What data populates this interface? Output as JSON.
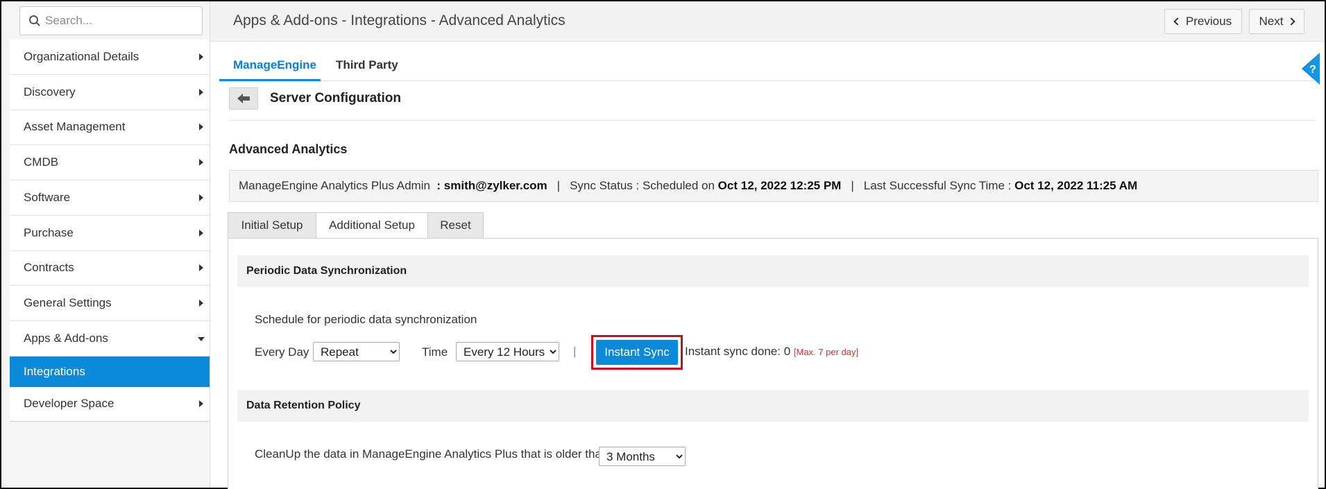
{
  "search": {
    "placeholder": "Search..."
  },
  "sidebar": {
    "items": [
      {
        "label": "Organizational Details"
      },
      {
        "label": "Discovery"
      },
      {
        "label": "Asset Management"
      },
      {
        "label": "CMDB"
      },
      {
        "label": "Software"
      },
      {
        "label": "Purchase"
      },
      {
        "label": "Contracts"
      },
      {
        "label": "General Settings"
      },
      {
        "label": "Apps & Add-ons"
      },
      {
        "label": "Integrations"
      },
      {
        "label": "Developer Space"
      }
    ]
  },
  "header": {
    "title": "Apps & Add-ons - Integrations - Advanced Analytics",
    "previous_label": "Previous",
    "next_label": "Next"
  },
  "tabs": [
    {
      "label": "ManageEngine"
    },
    {
      "label": "Third Party"
    }
  ],
  "server": {
    "title": "Server Configuration"
  },
  "section": {
    "title": "Advanced Analytics"
  },
  "info": {
    "admin_label": "ManageEngine Analytics Plus Admin",
    "admin_value": ": smith@zylker.com",
    "sync_status_label": "Sync Status : Scheduled on",
    "sync_status_value": "Oct 12, 2022 12:25 PM",
    "last_sync_label": "Last Successful Sync Time :",
    "last_sync_value": "Oct 12, 2022 11:25 AM",
    "separator": "|"
  },
  "subtabs": [
    {
      "label": "Initial Setup"
    },
    {
      "label": "Additional Setup"
    },
    {
      "label": "Reset"
    }
  ],
  "periodic": {
    "heading": "Periodic Data Synchronization",
    "schedule_text": "Schedule for periodic data synchronization",
    "every_day_label": "Every Day",
    "repeat_value": "Repeat",
    "time_label": "Time",
    "time_value": "Every 12 Hours",
    "divider": "|",
    "instant_sync_label": "Instant Sync",
    "sync_done_text": "Instant sync done: 0",
    "max_note": "[Max. 7 per day]"
  },
  "retention": {
    "heading": "Data Retention Policy",
    "cleanup_text": "CleanUp the data in ManageEngine Analytics Plus that is older than",
    "period_value": "3 Months"
  },
  "colors": {
    "accent": "#0a8ad8",
    "highlight_border": "#c8101a",
    "max_note": "#e02a2a"
  }
}
